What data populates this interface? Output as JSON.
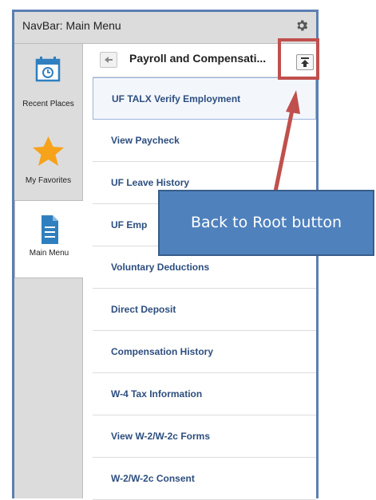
{
  "header": {
    "title": "NavBar: Main Menu",
    "icon": "gear-icon"
  },
  "rail": {
    "items": [
      {
        "label": "Recent Places",
        "icon": "calendar-clock-icon",
        "selected": false
      },
      {
        "label": "My Favorites",
        "icon": "star-icon",
        "selected": false
      },
      {
        "label": "Main Menu",
        "icon": "document-icon",
        "selected": true
      }
    ]
  },
  "content": {
    "title": "Payroll and Compensati...",
    "back_icon": "back-arrow-icon",
    "root_icon": "back-to-root-icon",
    "items": [
      "UF TALX Verify Employment",
      "View Paycheck",
      "UF Leave History",
      "UF Emp",
      "Voluntary Deductions",
      "Direct Deposit",
      "Compensation History",
      "W-4 Tax Information",
      "View W-2/W-2c Forms",
      "W-2/W-2c Consent"
    ]
  },
  "annotation": {
    "callout_text": "Back to Root button"
  },
  "colors": {
    "frame": "#5b7fb3",
    "link": "#2d4e7f",
    "callout": "#4f81bd",
    "highlight": "#c0504d",
    "favorite_star": "#f7a21b"
  }
}
